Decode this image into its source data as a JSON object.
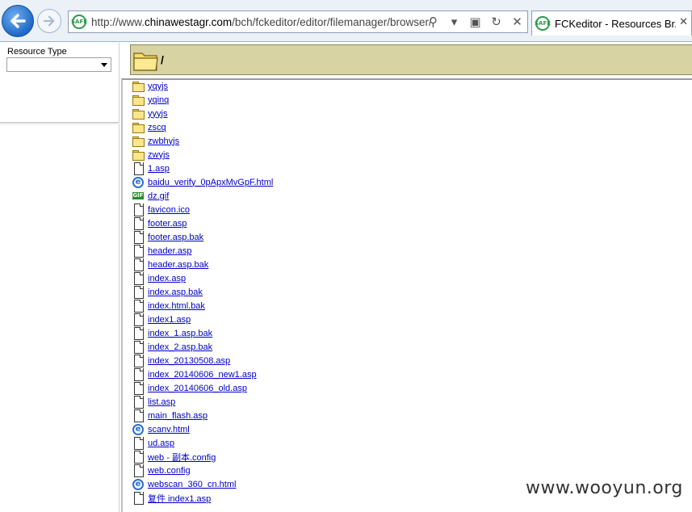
{
  "browser": {
    "url_prefix": "http://www.",
    "url_host": "chinawestagr.com",
    "url_path": "/bch/fckeditor/editor/filemanager/browser/",
    "tab_title": "FCKeditor - Resources Br...",
    "site_icon_text": "SAFE",
    "back_icon": "back-arrow-icon",
    "forward_icon": "forward-arrow-icon",
    "search_glyph": "⚲",
    "dropdown_glyph": "▾",
    "compat_glyph": "▣",
    "refresh_glyph": "↻",
    "stop_glyph": "✕",
    "tab_close_glyph": "✕"
  },
  "left_panel": {
    "resource_type_label": "Resource Type",
    "resource_type_value": ""
  },
  "path_bar": {
    "current_path": "/"
  },
  "files": [
    {
      "name": "yqyjs",
      "kind": "folder"
    },
    {
      "name": "yqinq",
      "kind": "folder"
    },
    {
      "name": "yyyjs",
      "kind": "folder"
    },
    {
      "name": "zscq",
      "kind": "folder"
    },
    {
      "name": "zwbhyjs",
      "kind": "folder"
    },
    {
      "name": "zwyjs",
      "kind": "folder"
    },
    {
      "name": "1.asp",
      "kind": "file"
    },
    {
      "name": "baidu_verify_0pApxMvGpF.html",
      "kind": "ie"
    },
    {
      "name": "dz.gif",
      "kind": "gif"
    },
    {
      "name": "favicon.ico",
      "kind": "file"
    },
    {
      "name": "footer.asp",
      "kind": "file"
    },
    {
      "name": "footer.asp.bak",
      "kind": "file"
    },
    {
      "name": "header.asp",
      "kind": "file"
    },
    {
      "name": "header.asp.bak",
      "kind": "file"
    },
    {
      "name": "index.asp",
      "kind": "file"
    },
    {
      "name": "index.asp.bak",
      "kind": "file"
    },
    {
      "name": "index.html.bak",
      "kind": "file"
    },
    {
      "name": "index1.asp",
      "kind": "file"
    },
    {
      "name": "index_1.asp.bak",
      "kind": "file"
    },
    {
      "name": "index_2.asp.bak",
      "kind": "file"
    },
    {
      "name": "index_20130508.asp",
      "kind": "file"
    },
    {
      "name": "index_20140606_new1.asp",
      "kind": "file"
    },
    {
      "name": "index_20140606_old.asp",
      "kind": "file"
    },
    {
      "name": "list.asp",
      "kind": "file"
    },
    {
      "name": "main_flash.asp",
      "kind": "file"
    },
    {
      "name": "scanv.html",
      "kind": "ie"
    },
    {
      "name": "ud.asp",
      "kind": "file"
    },
    {
      "name": "web - 副本.config",
      "kind": "file"
    },
    {
      "name": "web.config",
      "kind": "file"
    },
    {
      "name": "webscan_360_cn.html",
      "kind": "ie"
    },
    {
      "name": "复件 index1.asp",
      "kind": "file"
    }
  ],
  "file_type_badges": {
    "gif": "GIF",
    "ie": "e"
  },
  "watermark": "www.wooyun.org"
}
